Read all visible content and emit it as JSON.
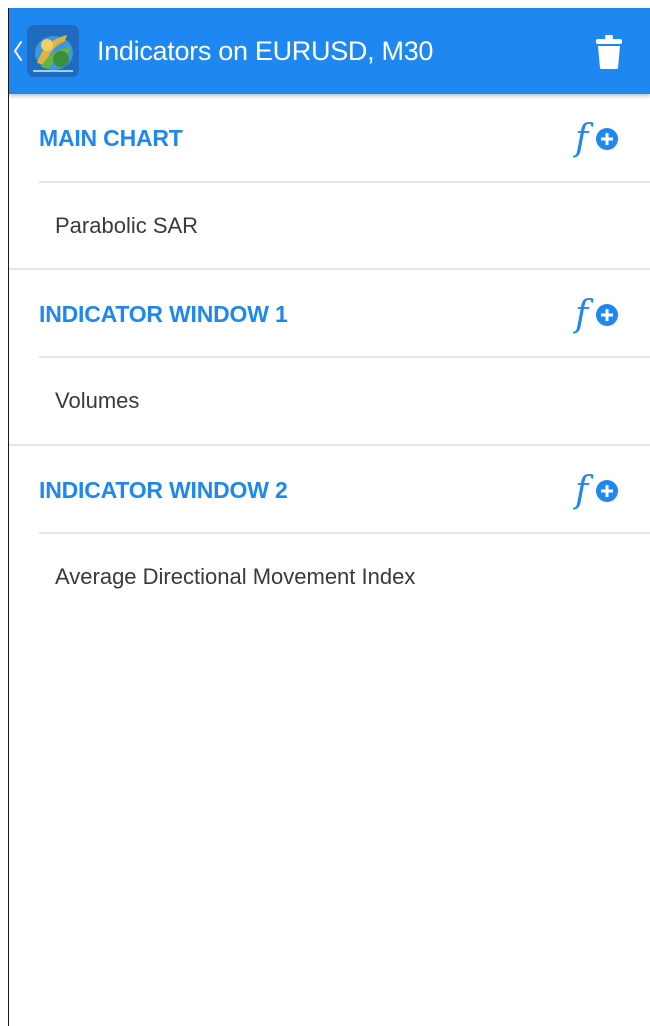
{
  "colors": {
    "accent": "#1e88f0",
    "toolbar_bg": "#1e88f0",
    "text_primary": "#3a3a3a",
    "divider": "#e6e6e6"
  },
  "toolbar": {
    "back_icon": "chevron-left-icon",
    "app_icon": "metatrader-app-icon",
    "title": "Indicators on EURUSD, M30",
    "action_icon": "trash-icon"
  },
  "sections": [
    {
      "title": "MAIN CHART",
      "action_icon": "add-function-icon",
      "items": [
        {
          "label": "Parabolic SAR"
        }
      ]
    },
    {
      "title": "INDICATOR WINDOW 1",
      "action_icon": "add-function-icon",
      "items": [
        {
          "label": "Volumes"
        }
      ]
    },
    {
      "title": "INDICATOR WINDOW 2",
      "action_icon": "add-function-icon",
      "items": [
        {
          "label": "Average Directional Movement Index"
        }
      ]
    }
  ]
}
